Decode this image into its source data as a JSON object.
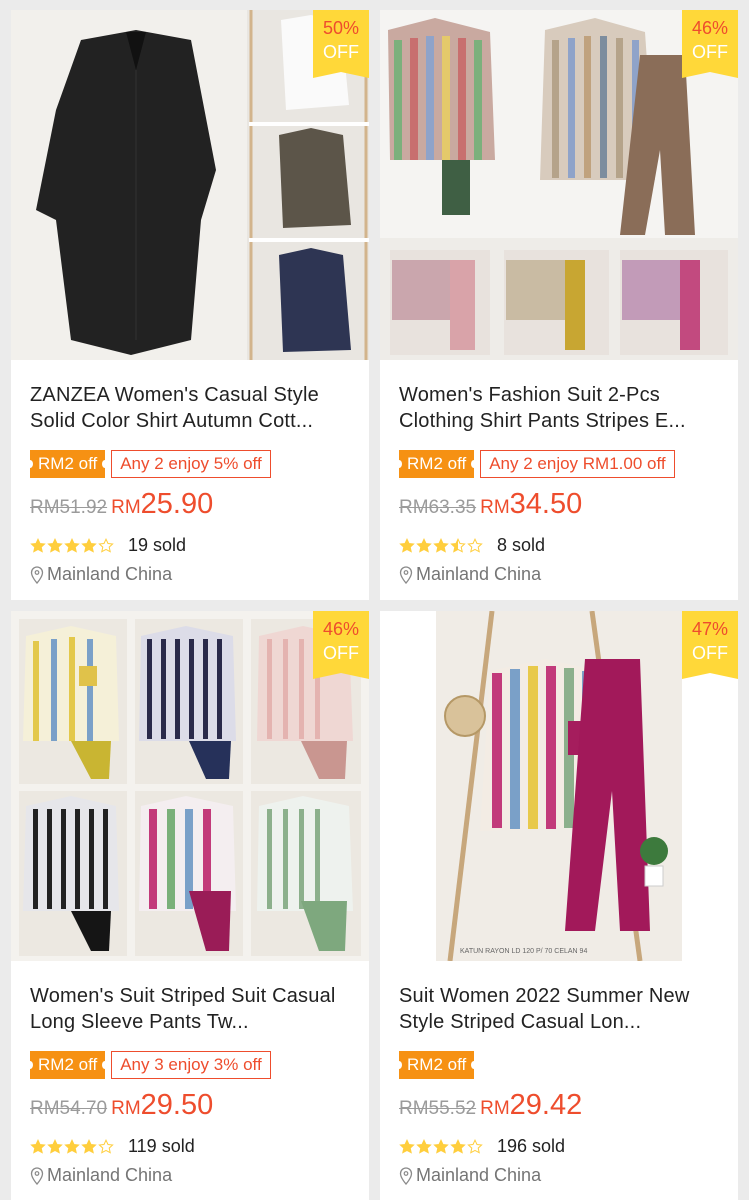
{
  "products": [
    {
      "badge_pct": "50%",
      "badge_off": "OFF",
      "title": "ZANZEA Women's Casual Style Solid Color Shirt Autumn Cott...",
      "promo_fill": "RM2 off",
      "promo_outline": "Any 2 enjoy 5% off",
      "old_price": "RM51.92",
      "price_currency": "RM",
      "price": "25.90",
      "rating": 4,
      "sold": "19 sold",
      "location": "Mainland China"
    },
    {
      "badge_pct": "46%",
      "badge_off": "OFF",
      "title": "Women's Fashion Suit 2-Pcs Clothing Shirt Pants Stripes E...",
      "promo_fill": "RM2 off",
      "promo_outline": "Any 2 enjoy RM1.00 off",
      "old_price": "RM63.35",
      "price_currency": "RM",
      "price": "34.50",
      "rating": 3.5,
      "sold": "8 sold",
      "location": "Mainland China"
    },
    {
      "badge_pct": "46%",
      "badge_off": "OFF",
      "title": "Women's Suit Striped Suit Casual Long Sleeve Pants Tw...",
      "promo_fill": "RM2 off",
      "promo_outline": "Any 3 enjoy 3% off",
      "old_price": "RM54.70",
      "price_currency": "RM",
      "price": "29.50",
      "rating": 4,
      "sold": "119 sold",
      "location": "Mainland China"
    },
    {
      "badge_pct": "47%",
      "badge_off": "OFF",
      "title": "Suit Women 2022 Summer New Style Striped Casual Lon...",
      "promo_fill": "RM2 off",
      "promo_outline": "",
      "old_price": "RM55.52",
      "price_currency": "RM",
      "price": "29.42",
      "rating": 4,
      "sold": "196 sold",
      "location": "Mainland China",
      "image_caption": "KATUN RAYON LD 120 P/ 70 CELAN 94"
    }
  ],
  "colors": {
    "accent": "#ee4d2d",
    "badge": "#ffd839",
    "promo": "#f69113",
    "star": "#ffce3d"
  }
}
